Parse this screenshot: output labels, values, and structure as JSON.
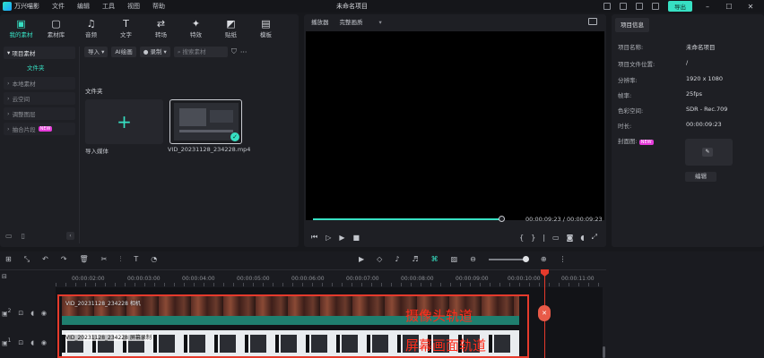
{
  "titlebar": {
    "app_name": "万兴喵影",
    "menu": [
      "文件",
      "编辑",
      "工具",
      "视图",
      "帮助"
    ],
    "doc_title": "未命名项目",
    "export_label": "导出"
  },
  "media_tabs": [
    {
      "label": "我的素材",
      "icon": "media-icon"
    },
    {
      "label": "素材库",
      "icon": "stock-icon"
    },
    {
      "label": "音频",
      "icon": "music-icon"
    },
    {
      "label": "文字",
      "icon": "text-icon"
    },
    {
      "label": "转场",
      "icon": "transition-icon"
    },
    {
      "label": "特效",
      "icon": "effects-icon"
    },
    {
      "label": "贴纸",
      "icon": "sticker-icon"
    },
    {
      "label": "模板",
      "icon": "template-icon"
    }
  ],
  "sidebar": {
    "header": "项目素材",
    "folder": "文件夹",
    "items": [
      "本地素材",
      "云空间",
      "调整图层",
      "抽合片段"
    ],
    "new_badge": "NEW"
  },
  "media_toolbar": {
    "import_label": "导入",
    "ai_label": "AI绘画",
    "record_label": "录制",
    "search_placeholder": "搜索素材"
  },
  "media_area": {
    "folder_label": "文件夹",
    "import_tile_label": "导入媒体",
    "clip_name": "VID_20231128_234228.mp4"
  },
  "player": {
    "label": "播放器",
    "quality": "完整画质",
    "time_current": "00:00:09:23",
    "time_total": "00:00:09:23",
    "progress": 1.0
  },
  "properties": {
    "tab": "项目信息",
    "rows": [
      {
        "label": "项目名称:",
        "value": "未命名项目"
      },
      {
        "label": "项目文件位置:",
        "value": "/"
      },
      {
        "label": "分辨率:",
        "value": "1920 x 1080"
      },
      {
        "label": "帧率:",
        "value": "25fps"
      },
      {
        "label": "色彩空间:",
        "value": "SDR - Rec.709"
      },
      {
        "label": "时长:",
        "value": "00:00:09:23"
      }
    ],
    "cover_label": "封面图:",
    "cover_badge": "NEW",
    "edit_label": "编辑"
  },
  "timeline": {
    "ruler": [
      "00:00:02:00",
      "00:00:03:00",
      "00:00:04:00",
      "00:00:05:00",
      "00:00:06:00",
      "00:00:07:00",
      "00:00:08:00",
      "00:00:09:00",
      "00:00:10:00",
      "00:00:11:00"
    ],
    "track1_clip": "VID_20231128_234228 相机",
    "track2_clip": "VID_20231128_234228 屏幕录制",
    "annotation_top": "摄像头轨道",
    "annotation_bottom": "屏幕画面轨道",
    "track_numbers": [
      "2",
      "1"
    ]
  },
  "colors": {
    "accent": "#37e0c3",
    "annotation": "#ff2d1c"
  }
}
